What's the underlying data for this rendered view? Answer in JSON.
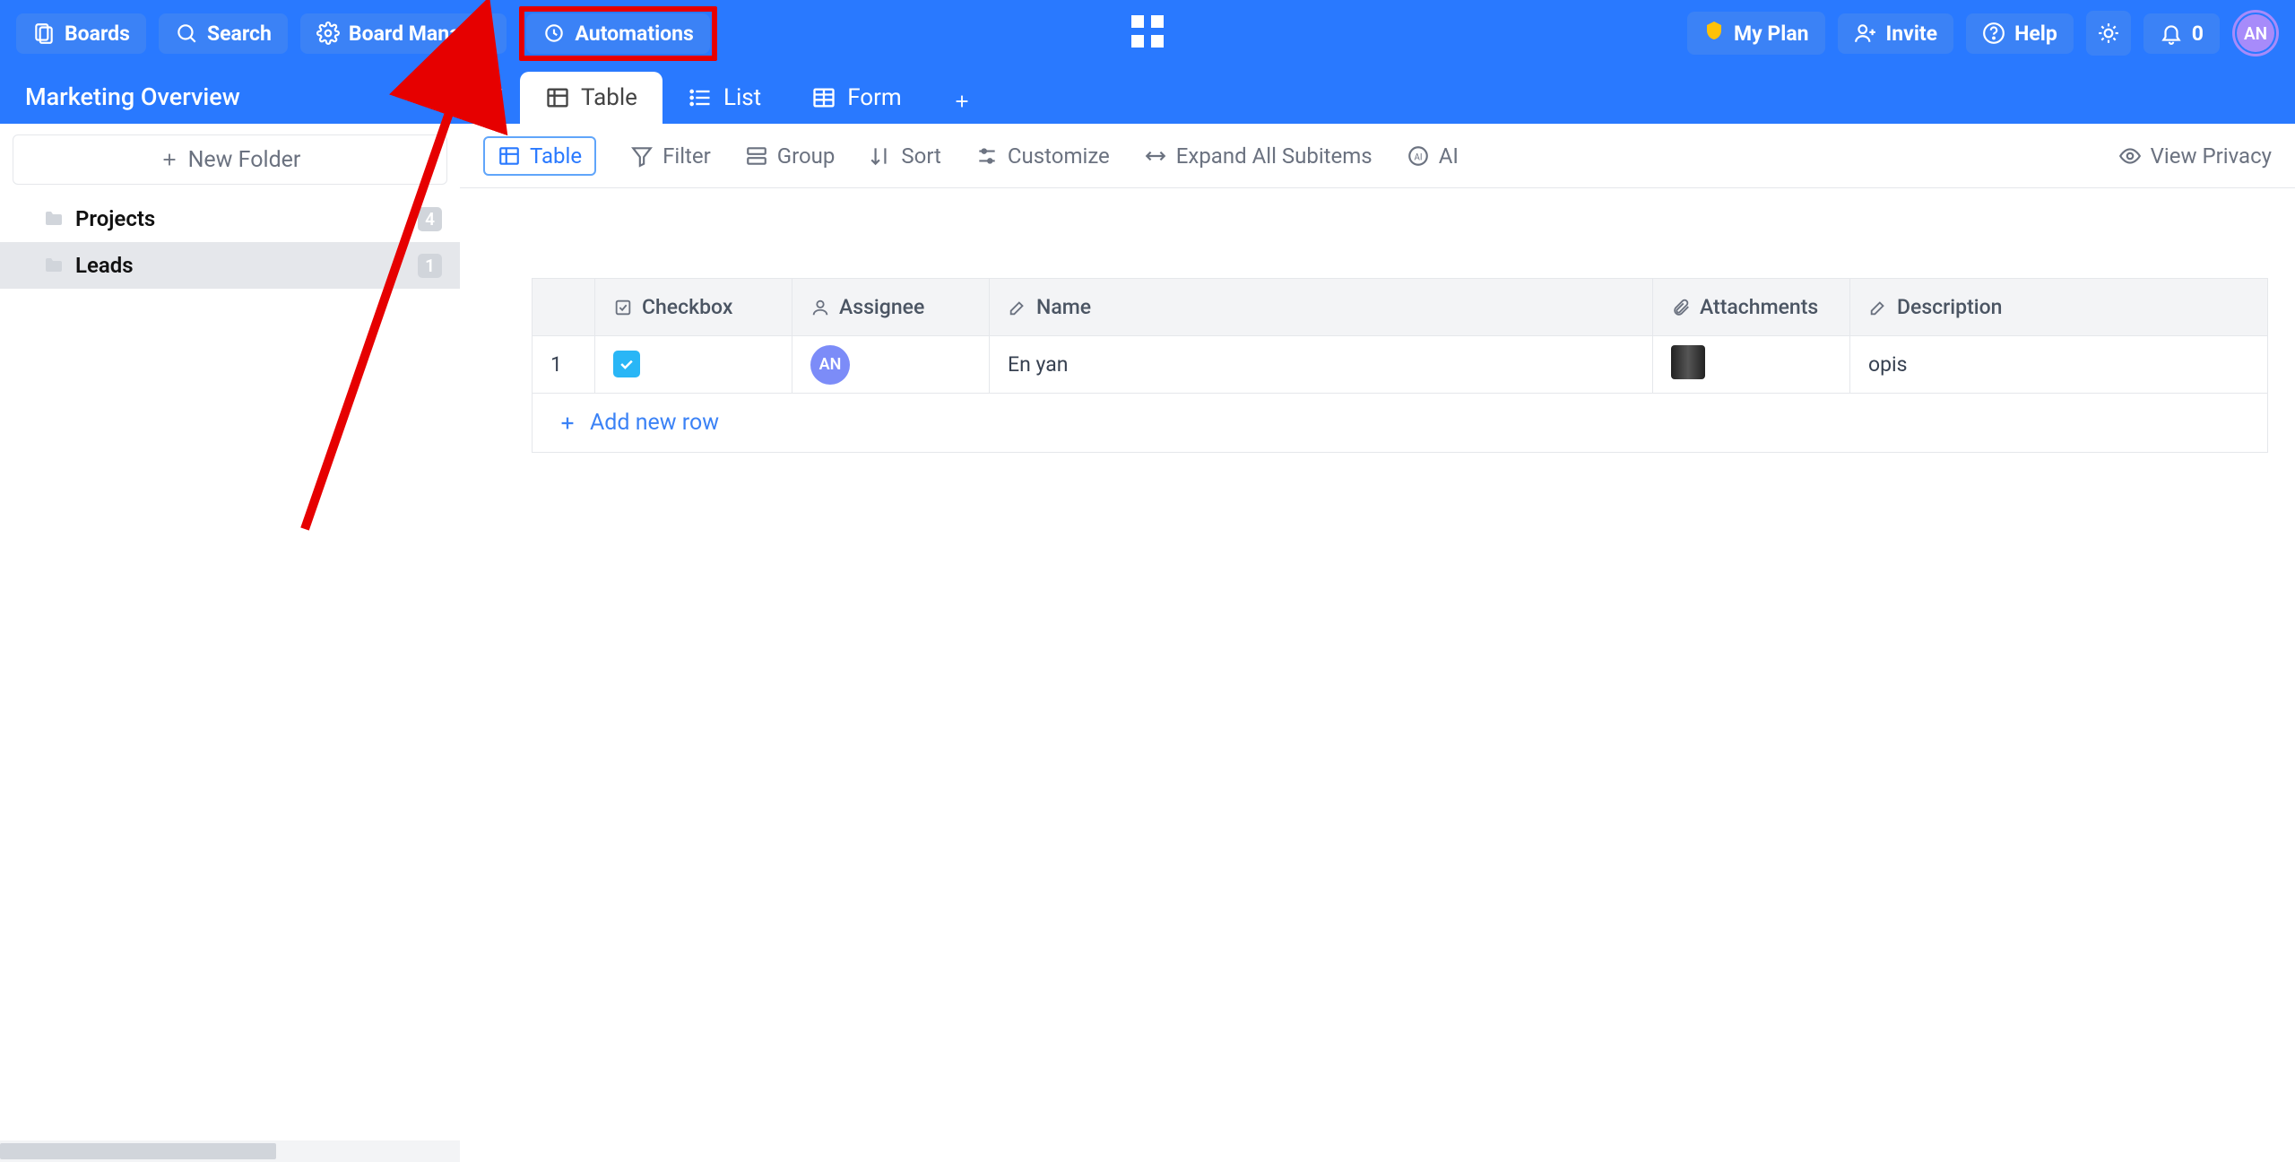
{
  "topnav": {
    "boards": "Boards",
    "search": "Search",
    "board_manager": "Board Manager",
    "automations": "Automations",
    "my_plan": "My Plan",
    "invite": "Invite",
    "help": "Help",
    "bell_count": "0",
    "avatar_initials": "AN"
  },
  "board": {
    "title": "Marketing Overview"
  },
  "view_tabs": {
    "table": "Table",
    "list": "List",
    "form": "Form"
  },
  "sidebar": {
    "new_folder": "New Folder",
    "items": [
      {
        "label": "Projects",
        "count": "4"
      },
      {
        "label": "Leads",
        "count": "1"
      }
    ]
  },
  "toolbar": {
    "table": "Table",
    "filter": "Filter",
    "group": "Group",
    "sort": "Sort",
    "customize": "Customize",
    "expand": "Expand All Subitems",
    "ai": "AI",
    "view_privacy": "View Privacy"
  },
  "columns": {
    "checkbox": "Checkbox",
    "assignee": "Assignee",
    "name": "Name",
    "attachments": "Attachments",
    "description": "Description"
  },
  "rows": [
    {
      "num": "1",
      "checked": true,
      "assignee_initials": "AN",
      "name": "En yan",
      "description": "opis"
    }
  ],
  "add_row": "Add new row"
}
